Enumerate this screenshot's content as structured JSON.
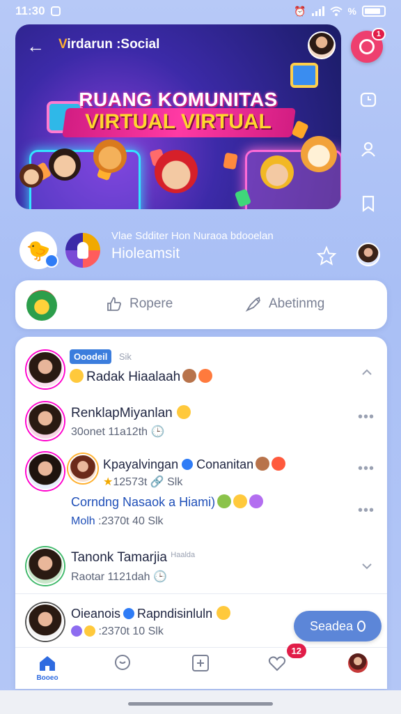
{
  "status": {
    "time": "11:30",
    "battery_label": "%"
  },
  "banner": {
    "app_name_prefix": "V",
    "app_name": "irdarun :Social",
    "title_line1": "RUANG KOMUNITAS",
    "title_line2": "VIRTUAL VIRTUAL"
  },
  "rail": {
    "notify_badge": "1"
  },
  "info": {
    "subtitle": "Vlae Sdditer Hon Nuraoa bdooelan",
    "title": "Hioleamsit"
  },
  "actions": {
    "reply_label": "Ropere",
    "repost_label": "Abetinmg"
  },
  "posts": [
    {
      "tag": "Ooodeil",
      "count": "Sik",
      "name": "Radak Hiaalaah"
    },
    {
      "name": "RenklapMiyanlan",
      "meta": "30onet 11a12th"
    },
    {
      "name": "Kpayalvingan",
      "name2": "Conanitan",
      "meta": "12573t",
      "meta2": "Slk",
      "comment": "Corndng Nasaok a Hiami)",
      "comment_author": "Molh",
      "comment_meta": ":2370t",
      "comment_meta2": "40 Slk"
    },
    {
      "name": "Tanonk Tamarjia",
      "badge": "Haalda",
      "meta": "Raotar 1121dah"
    },
    {
      "name": "Oieanois",
      "name2": "Rapndisinluln",
      "meta": ":2370t",
      "meta2": "10 Slk"
    }
  ],
  "send_label": "Seadea",
  "nav": {
    "home_label": "Booeo",
    "notify_badge": "12"
  },
  "colors": {
    "accent": "#2f6be0",
    "badge": "#e11d48",
    "send": "#5c86d8",
    "background": "#b0c4f6"
  }
}
